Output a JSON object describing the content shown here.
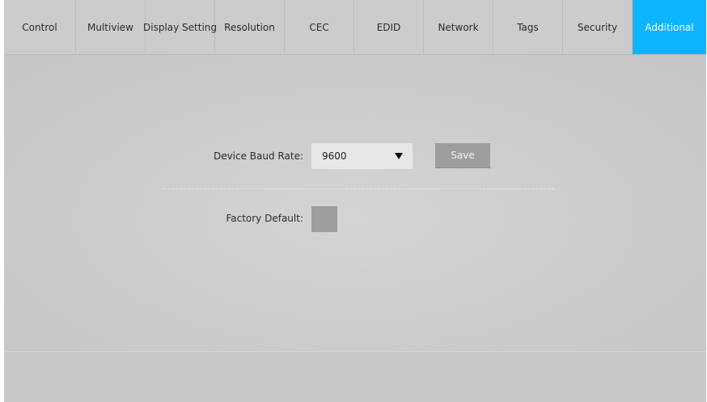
{
  "tabs": [
    {
      "label": "Control",
      "active": false
    },
    {
      "label": "Multiview",
      "active": false
    },
    {
      "label": "Display Setting",
      "active": false
    },
    {
      "label": "Resolution",
      "active": false
    },
    {
      "label": "CEC",
      "active": false
    },
    {
      "label": "EDID",
      "active": false
    },
    {
      "label": "Network",
      "active": false
    },
    {
      "label": "Tags",
      "active": false
    },
    {
      "label": "Security",
      "active": false
    },
    {
      "label": "Additional",
      "active": true
    }
  ],
  "additional": {
    "baud_rate_label": "Device Baud Rate:",
    "baud_rate_value": "9600",
    "save_label": "Save",
    "factory_default_label": "Factory Default:"
  },
  "colors": {
    "active_tab": "#0db4ff",
    "background": "#cbcbcb",
    "button": "#9e9e9e"
  },
  "icons": {
    "dropdown": "caret-down-icon"
  }
}
